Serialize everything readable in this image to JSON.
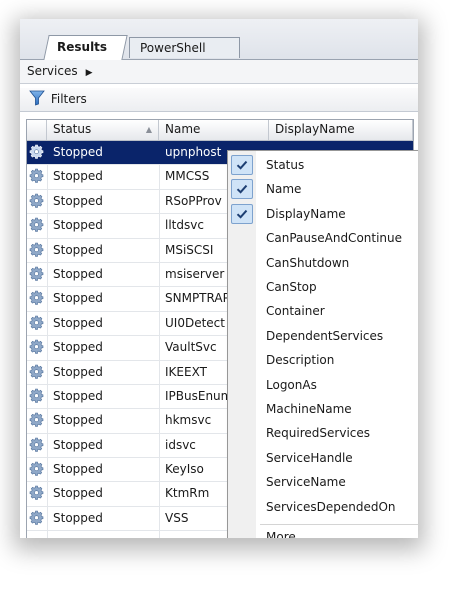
{
  "tabs": [
    {
      "label": "Results",
      "active": true
    },
    {
      "label": "PowerShell Script",
      "active": false
    }
  ],
  "breadcrumb": {
    "label": "Services"
  },
  "filters": {
    "label": "Filters"
  },
  "grid": {
    "columns": [
      "Status",
      "Name",
      "DisplayName"
    ],
    "rows": [
      {
        "status": "Stopped",
        "name": "upnphost",
        "selected": true
      },
      {
        "status": "Stopped",
        "name": "MMCSS"
      },
      {
        "status": "Stopped",
        "name": "RSoPProv"
      },
      {
        "status": "Stopped",
        "name": "lltdsvc"
      },
      {
        "status": "Stopped",
        "name": "MSiSCSI"
      },
      {
        "status": "Stopped",
        "name": "msiserver"
      },
      {
        "status": "Stopped",
        "name": "SNMPTRAP"
      },
      {
        "status": "Stopped",
        "name": "UI0Detect"
      },
      {
        "status": "Stopped",
        "name": "VaultSvc"
      },
      {
        "status": "Stopped",
        "name": "IKEEXT"
      },
      {
        "status": "Stopped",
        "name": "IPBusEnum"
      },
      {
        "status": "Stopped",
        "name": "hkmsvc"
      },
      {
        "status": "Stopped",
        "name": "idsvc"
      },
      {
        "status": "Stopped",
        "name": "KeyIso"
      },
      {
        "status": "Stopped",
        "name": "KtmRm"
      },
      {
        "status": "Stopped",
        "name": "VSS"
      }
    ]
  },
  "context_menu": {
    "items": [
      {
        "label": "Status",
        "checked": true
      },
      {
        "label": "Name",
        "checked": true
      },
      {
        "label": "DisplayName",
        "checked": true
      },
      {
        "label": "CanPauseAndContinue",
        "checked": false
      },
      {
        "label": "CanShutdown",
        "checked": false
      },
      {
        "label": "CanStop",
        "checked": false
      },
      {
        "label": "Container",
        "checked": false
      },
      {
        "label": "DependentServices",
        "checked": false
      },
      {
        "label": "Description",
        "checked": false
      },
      {
        "label": "LogonAs",
        "checked": false
      },
      {
        "label": "MachineName",
        "checked": false
      },
      {
        "label": "RequiredServices",
        "checked": false
      },
      {
        "label": "ServiceHandle",
        "checked": false
      },
      {
        "label": "ServiceName",
        "checked": false
      },
      {
        "label": "ServicesDependedOn",
        "checked": false
      }
    ],
    "more_label": "More..."
  },
  "colors": {
    "selection": "#0a246a",
    "check_bg": "#cfe3f7",
    "check_border": "#7da2ce"
  }
}
